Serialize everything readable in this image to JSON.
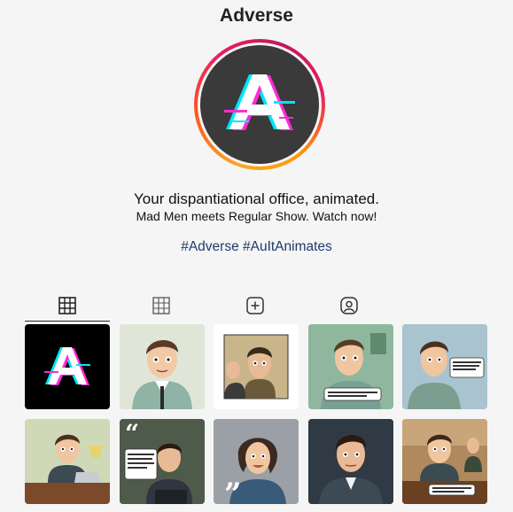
{
  "profile": {
    "name": "Adverse",
    "bio_line1": "Your dispantiational office, animated.",
    "bio_line2": "Mad Men meets Regular Show. Watch now!",
    "hashtags": "#Adverse #AuItAnimates"
  },
  "tabs": [
    {
      "icon": "grid-icon",
      "active": true
    },
    {
      "icon": "grid-icon",
      "active": false
    },
    {
      "icon": "plus-square-icon",
      "active": false
    },
    {
      "icon": "tagged-person-icon",
      "active": false
    }
  ],
  "colors": {
    "ring_gradient": [
      "#f9a825",
      "#e91e63",
      "#ff9800"
    ],
    "avatar_bg": "#3a3a3a",
    "hashtag": "#1f3a6b",
    "tab_icon": "#333333",
    "glitch_cyan": "#00e5ff",
    "glitch_magenta": "#ff2bd6"
  },
  "posts": [
    {
      "kind": "logo"
    },
    {
      "kind": "cartoon-man",
      "bg": "#dfe6d8"
    },
    {
      "kind": "cartoon-framed",
      "bg": "#ffffff"
    },
    {
      "kind": "cartoon-speech",
      "bg": "#8fb79e"
    },
    {
      "kind": "cartoon-speech",
      "bg": "#a9c3cf"
    },
    {
      "kind": "cartoon-desk",
      "bg": "#cfd9b8"
    },
    {
      "kind": "cartoon-quote",
      "bg": "#4e5a4a"
    },
    {
      "kind": "cartoon-quote-woman",
      "bg": "#9aa0a6"
    },
    {
      "kind": "cartoon-dark",
      "bg": "#2f3a44"
    },
    {
      "kind": "cartoon-desk-speech",
      "bg": "#b08a5e"
    }
  ]
}
